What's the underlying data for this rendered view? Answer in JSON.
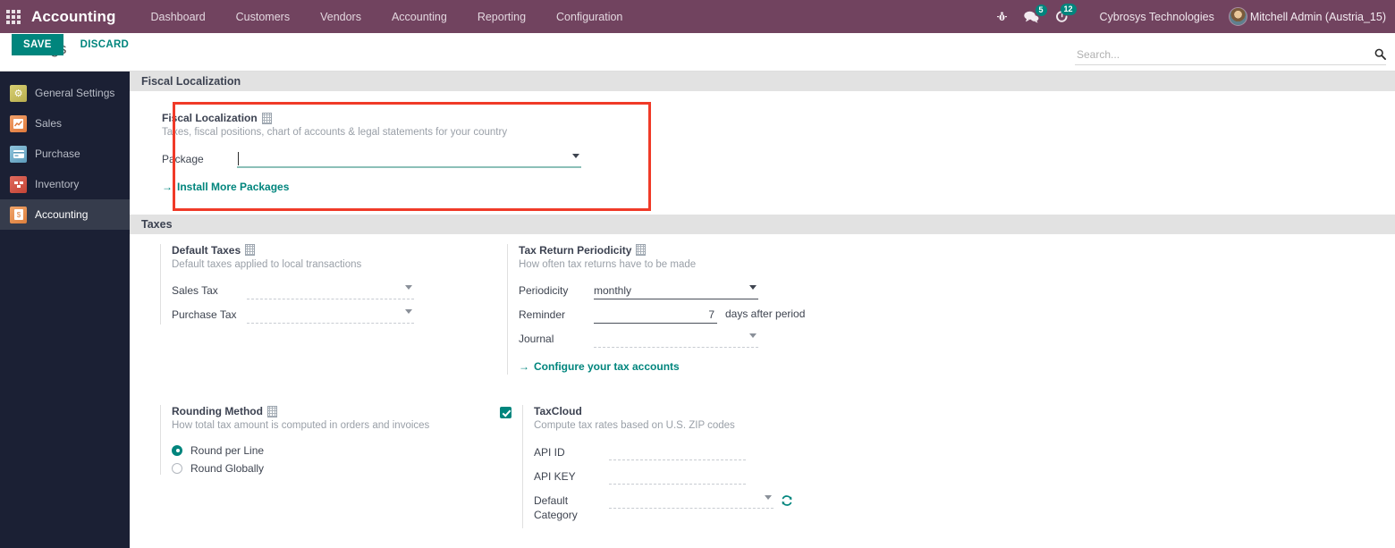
{
  "navbar": {
    "apps_icon": "apps-grid-icon",
    "brand": "Accounting",
    "menu": [
      {
        "label": "Dashboard"
      },
      {
        "label": "Customers"
      },
      {
        "label": "Vendors"
      },
      {
        "label": "Accounting"
      },
      {
        "label": "Reporting"
      },
      {
        "label": "Configuration"
      }
    ],
    "debug_icon": "bug-icon",
    "messages_icon": "chat-bubble-icon",
    "messages_count": "5",
    "activities_icon": "clock-icon",
    "activities_count": "12",
    "company": "Cybrosys Technologies",
    "user": "Mitchell Admin (Austria_15)",
    "avatar_icon": "user-avatar",
    "accent_color": "#71435f",
    "badge_color": "#00857d"
  },
  "control_panel": {
    "title": "Settings",
    "search_placeholder": "Search...",
    "search_value": "",
    "search_icon": "search-icon",
    "save_label": "SAVE",
    "discard_label": "DISCARD"
  },
  "sidebar": {
    "items": [
      {
        "label": "General Settings",
        "icon": "gear-icon",
        "active": false
      },
      {
        "label": "Sales",
        "icon": "chart-icon",
        "active": false
      },
      {
        "label": "Purchase",
        "icon": "card-icon",
        "active": false
      },
      {
        "label": "Inventory",
        "icon": "boxes-icon",
        "active": false
      },
      {
        "label": "Accounting",
        "icon": "invoice-icon",
        "active": true
      }
    ]
  },
  "sections": {
    "fiscal_localization": {
      "header": "Fiscal Localization",
      "block": {
        "title": "Fiscal Localization",
        "company_icon": "company-building-icon",
        "desc": "Taxes, fiscal positions, chart of accounts & legal statements for your country",
        "package_label": "Package",
        "package_value": "",
        "link": "Install More Packages",
        "link_arrow": "→"
      },
      "highlight_color": "#f03a28"
    },
    "taxes": {
      "header": "Taxes",
      "default_taxes": {
        "title": "Default Taxes",
        "company_icon": "company-building-icon",
        "desc": "Default taxes applied to local transactions",
        "sales_tax_label": "Sales Tax",
        "sales_tax_value": "",
        "purchase_tax_label": "Purchase Tax",
        "purchase_tax_value": ""
      },
      "tax_return_periodicity": {
        "title": "Tax Return Periodicity",
        "company_icon": "company-building-icon",
        "desc": "How often tax returns have to be made",
        "periodicity_label": "Periodicity",
        "periodicity_value": "monthly",
        "reminder_label": "Reminder",
        "reminder_value": "7",
        "reminder_suffix": "days after period",
        "journal_label": "Journal",
        "journal_value": "",
        "link": "Configure your tax accounts",
        "link_arrow": "→"
      },
      "rounding_method": {
        "title": "Rounding Method",
        "company_icon": "company-building-icon",
        "desc": "How total tax amount is computed in orders and invoices",
        "options": [
          {
            "label": "Round per Line",
            "selected": true
          },
          {
            "label": "Round Globally",
            "selected": false
          }
        ]
      },
      "taxcloud": {
        "title": "TaxCloud",
        "enabled": true,
        "desc": "Compute tax rates based on U.S. ZIP codes",
        "api_id_label": "API ID",
        "api_id_value": "",
        "api_key_label": "API KEY",
        "api_key_value": "",
        "default_category_label": "Default Category",
        "default_category_value": "",
        "refresh_icon": "refresh-icon"
      }
    }
  }
}
